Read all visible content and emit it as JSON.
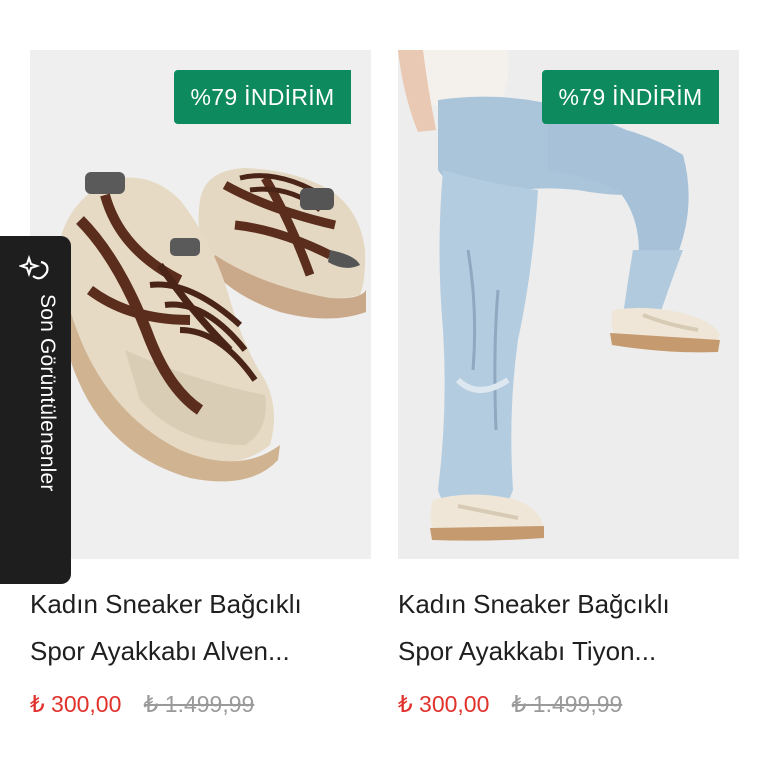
{
  "products": [
    {
      "discount_badge": "%79 İNDİRİM",
      "title_line1": "Kadın Sneaker Bağcıklı",
      "title_line2": "Spor Ayakkabı Alven...",
      "price": "₺ 300,00",
      "old_price": "₺ 1.499,99",
      "image": "sneaker-pair-photo"
    },
    {
      "discount_badge": "%79 İNDİRİM",
      "title_line1": "Kadın Sneaker Bağcıklı",
      "title_line2": "Spor Ayakkabı Tiyon...",
      "price": "₺ 300,00",
      "old_price": "₺ 1.499,99",
      "image": "model-wearing-sneakers-photo"
    }
  ],
  "recently_viewed": {
    "label": "Son Görüntülenenler",
    "icon": "sparkle-icon"
  },
  "colors": {
    "badge": "#0d8a5e",
    "price": "#e0312b",
    "old_price": "#9a9a9a",
    "tab": "#1e1e1e"
  }
}
